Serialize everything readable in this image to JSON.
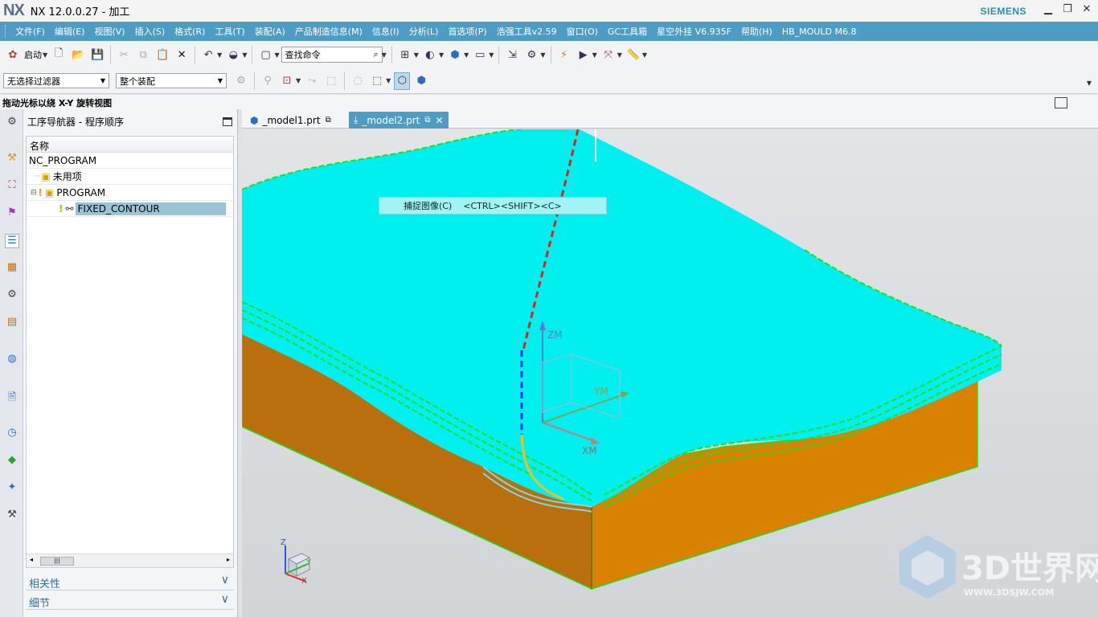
{
  "window": {
    "logo": "NX",
    "title": "NX 12.0.0.27 - 加工",
    "brand": "SIEMENS",
    "minimize_icon": "minimize-icon",
    "restore_icon": "restore-icon",
    "close_icon": "close-icon"
  },
  "menu": [
    "文件(F)",
    "编辑(E)",
    "视图(V)",
    "插入(S)",
    "格式(R)",
    "工具(T)",
    "装配(A)",
    "产品制造信息(M)",
    "信息(I)",
    "分析(L)",
    "首选项(P)",
    "浩强工具v2.59",
    "窗口(O)",
    "GC工具箱",
    "星空外挂 V6.935F",
    "帮助(H)",
    "HB_MOULD M6.8"
  ],
  "toolbar": {
    "start_label": "启动",
    "search_placeholder": "查找命令"
  },
  "filters": {
    "selection_filter": "无选择过滤器",
    "assembly_scope": "整个装配"
  },
  "status_hint": "拖动光标以绕 X-Y 旋转视图",
  "navigator": {
    "title": "工序导航器 - 程序顺序",
    "column_header": "名称",
    "tree": [
      {
        "label": "NC_PROGRAM",
        "level": 0,
        "selected": false
      },
      {
        "label": "未用项",
        "level": 1,
        "selected": false
      },
      {
        "label": "PROGRAM",
        "level": 1,
        "selected": false
      },
      {
        "label": "FIXED_CONTOUR",
        "level": 2,
        "selected": true
      }
    ],
    "sections": [
      "相关性",
      "细节"
    ]
  },
  "tabs": [
    {
      "label": "_model1.prt",
      "active": false
    },
    {
      "label": "_model2.prt",
      "active": true
    }
  ],
  "context_menu": {
    "item": "捕捉图像(C)",
    "shortcut": "<CTRL><SHIFT><C>"
  },
  "viewport": {
    "axis_labels": {
      "zm": "ZM",
      "ym": "YM",
      "xm": "XM"
    },
    "triad_labels": {
      "z": "Z",
      "y": "Y",
      "x": "X"
    },
    "watermark_main": "3D世界网",
    "watermark_url": "WWW.3DSJW.COM"
  },
  "colors": {
    "menubar": "#4e9bc4",
    "toolpath_surface": "#00f0f0",
    "stock_side_light": "#d98200",
    "stock_side_dark": "#b86f0c",
    "toolpath_green": "#22dd22"
  }
}
